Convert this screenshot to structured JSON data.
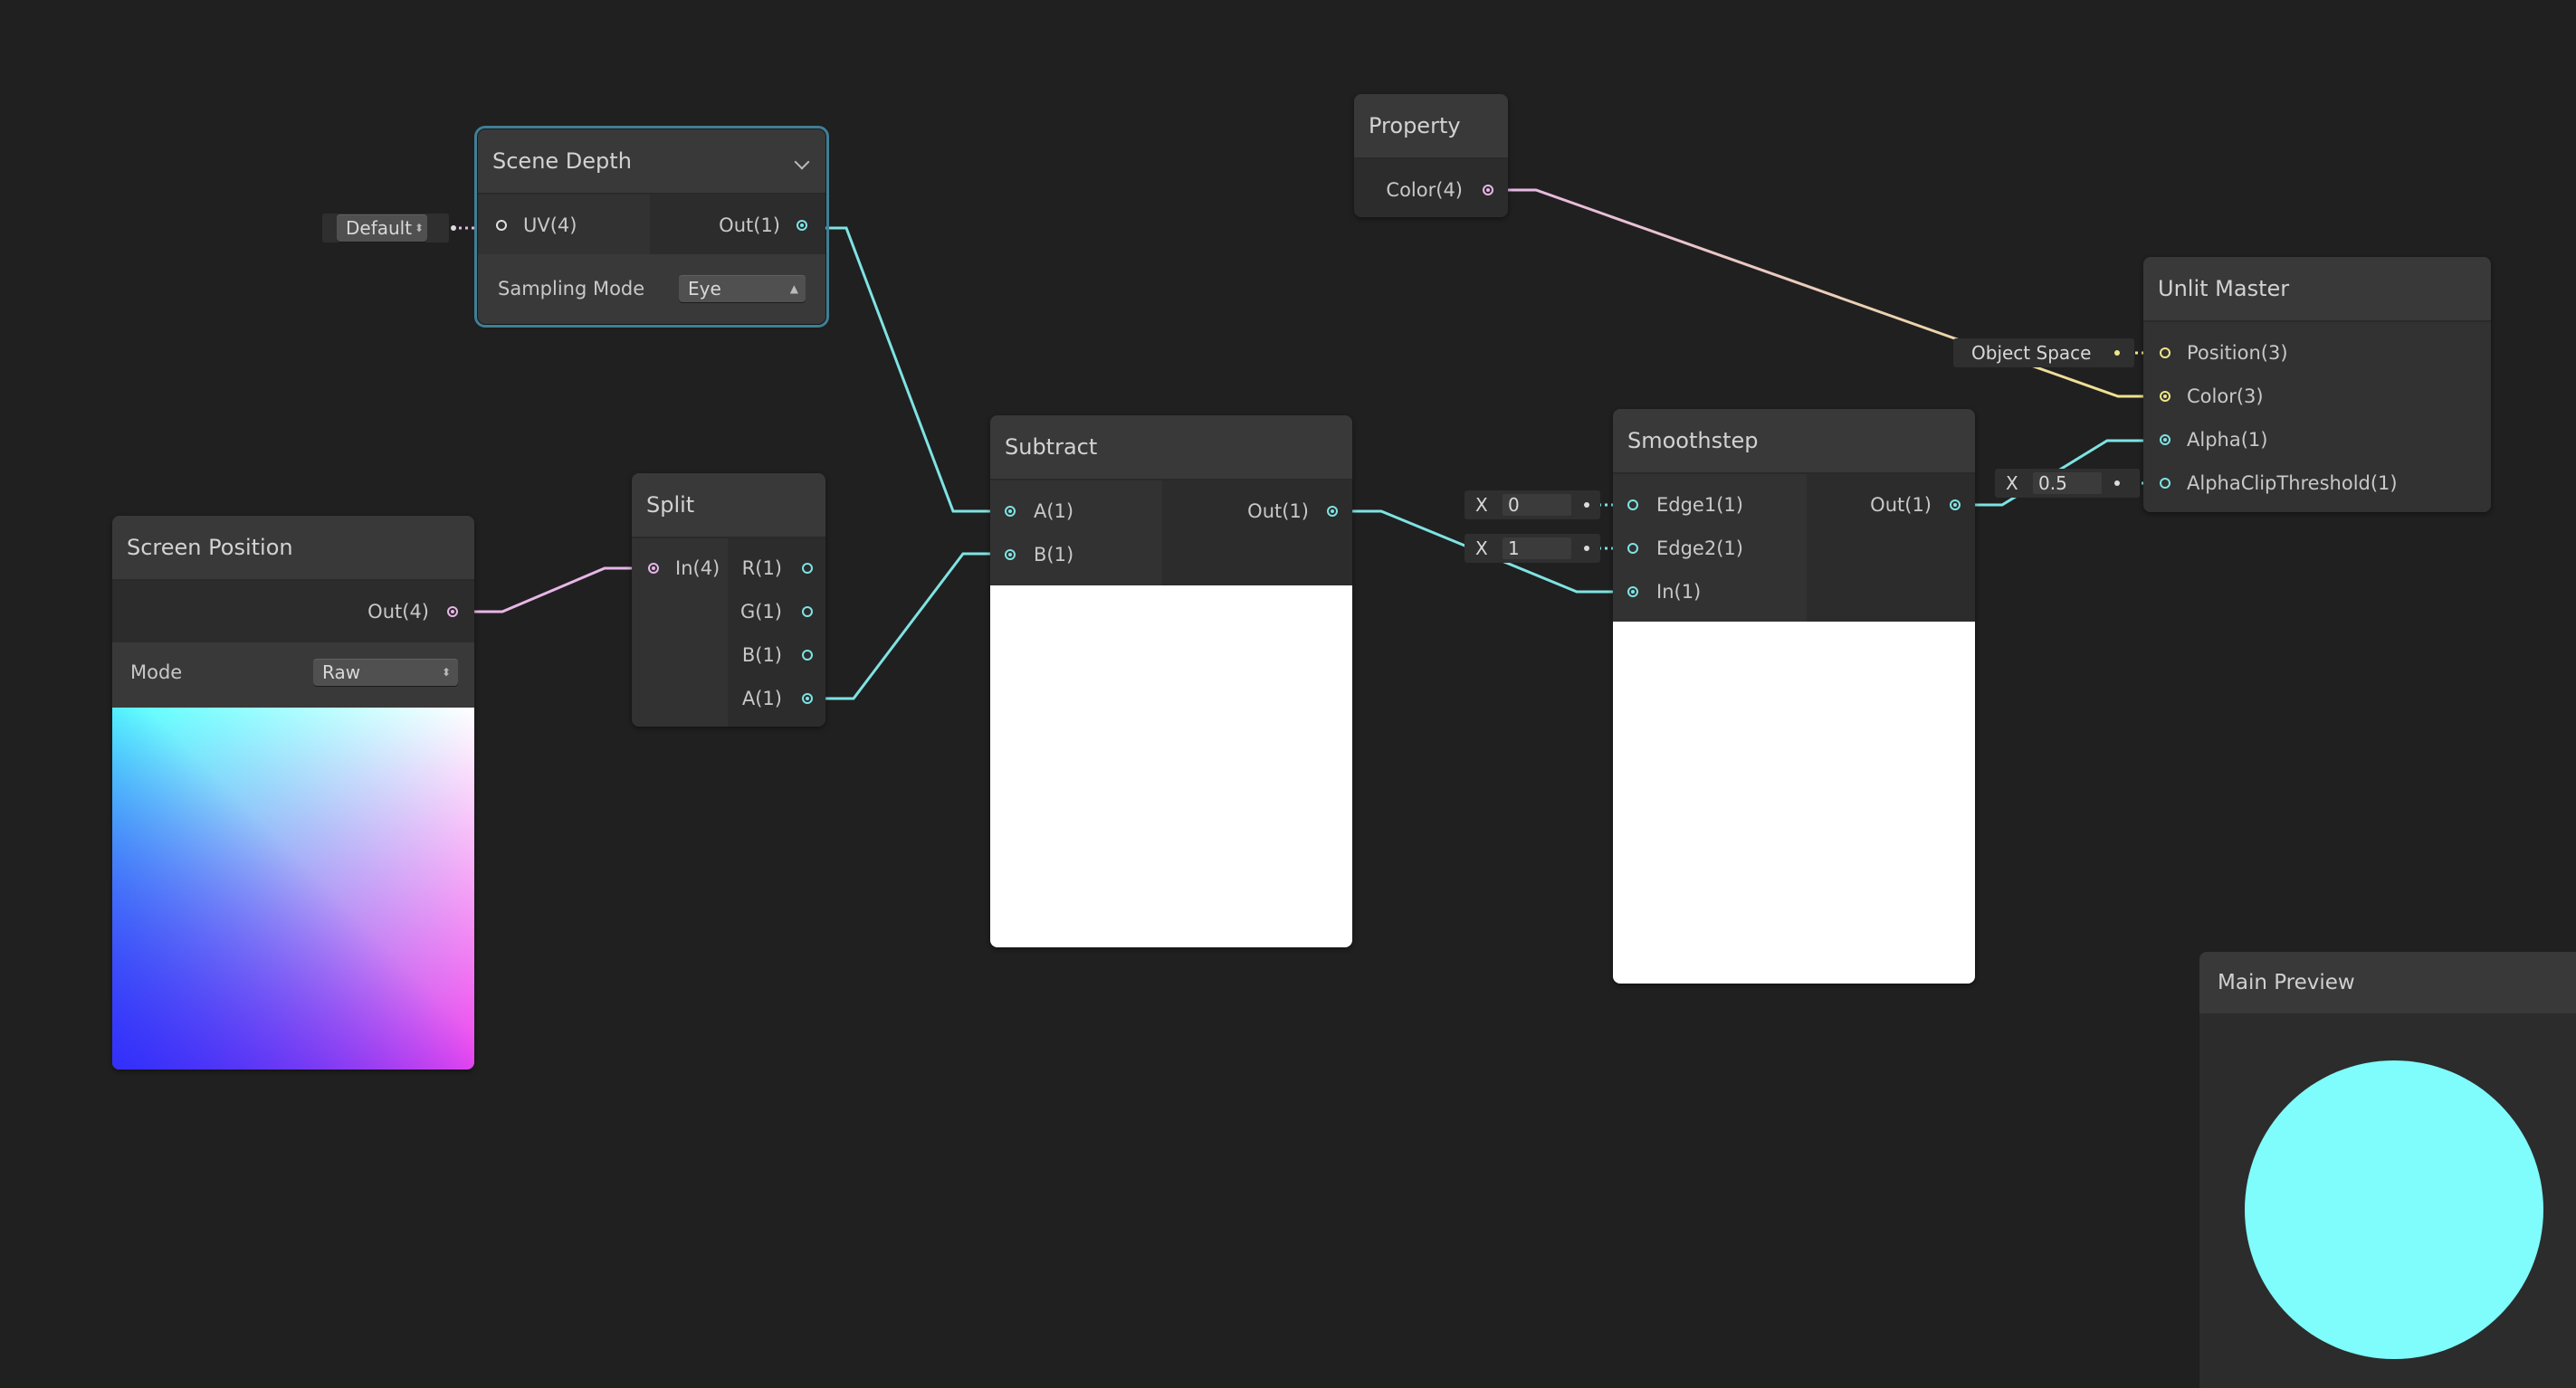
{
  "nodes": {
    "scene_depth": {
      "title": "Scene Depth",
      "input": "UV(4)",
      "output": "Out(1)",
      "sampling_label": "Sampling Mode",
      "sampling_value": "Eye",
      "uv_default": "Default"
    },
    "property": {
      "title": "Property",
      "output": "Color(4)"
    },
    "screen_position": {
      "title": "Screen Position",
      "output": "Out(4)",
      "mode_label": "Mode",
      "mode_value": "Raw"
    },
    "split": {
      "title": "Split",
      "input": "In(4)",
      "outputs": [
        "R(1)",
        "G(1)",
        "B(1)",
        "A(1)"
      ]
    },
    "subtract": {
      "title": "Subtract",
      "inputs": [
        "A(1)",
        "B(1)"
      ],
      "output": "Out(1)"
    },
    "smoothstep": {
      "title": "Smoothstep",
      "inputs": [
        "Edge1(1)",
        "Edge2(1)",
        "In(1)"
      ],
      "output": "Out(1)",
      "edge1_axis": "X",
      "edge1_value": "0",
      "edge2_axis": "X",
      "edge2_value": "1"
    },
    "unlit_master": {
      "title": "Unlit Master",
      "inputs": [
        "Position(3)",
        "Color(3)",
        "Alpha(1)",
        "AlphaClipThreshold(1)"
      ],
      "position_space": "Object Space",
      "clip_axis": "X",
      "clip_value": "0.5"
    }
  },
  "main_preview": {
    "title": "Main Preview"
  },
  "colors": {
    "background": "#202020",
    "node": "#393939",
    "wire_cyan": "#7fe3e3",
    "wire_pink": "#e7b6e7",
    "wire_yellow": "#efe58b",
    "preview_sphere": "#7ffcfc"
  }
}
